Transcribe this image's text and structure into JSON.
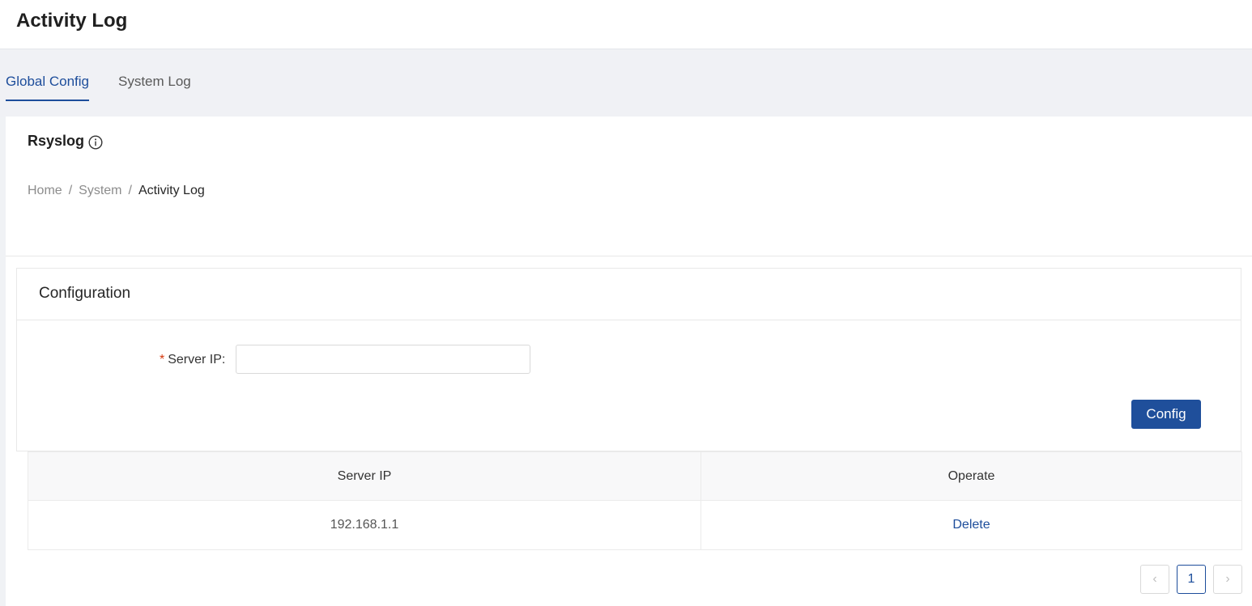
{
  "header": {
    "title": "Activity Log"
  },
  "tabs": [
    {
      "label": "Global Config",
      "active": true
    },
    {
      "label": "System Log",
      "active": false
    }
  ],
  "section": {
    "title": "Rsyslog",
    "icon": "info-icon"
  },
  "breadcrumb": {
    "home": "Home",
    "sep": "/",
    "system": "System",
    "current": "Activity Log"
  },
  "card": {
    "title": "Configuration",
    "field_required": "*",
    "field_label": "Server IP:",
    "field_value": "",
    "button_label": "Config"
  },
  "table": {
    "headers": [
      "Server IP",
      "Operate"
    ],
    "rows": [
      {
        "server_ip": "192.168.1.1",
        "operate": "Delete"
      }
    ]
  },
  "pagination": {
    "prev": "‹",
    "current": "1",
    "next": "›"
  },
  "colors": {
    "accent": "#1d4d9b",
    "button": "#1f4f9b",
    "required": "#d4380d"
  }
}
